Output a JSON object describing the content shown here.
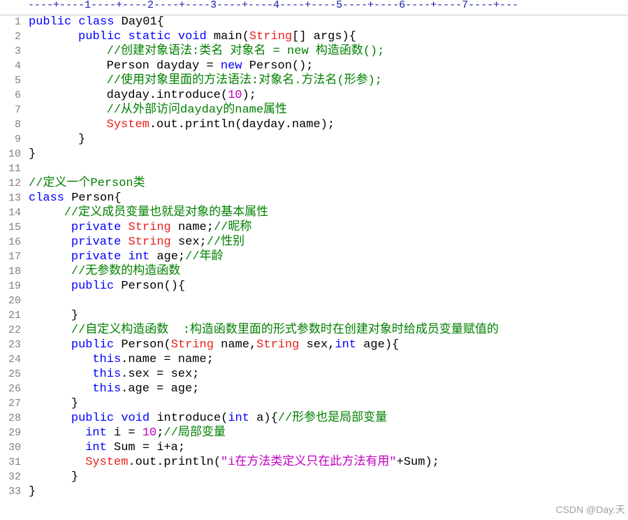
{
  "ruler": "----+----1----+----2----+----3----+----4----+----5----+----6----+----7----+---",
  "watermark": "CSDN @Day.天",
  "colors": {
    "keyword": "#0000ff",
    "type": "#e8201a",
    "comment": "#008000",
    "number": "#c000c0",
    "string": "#c000c0",
    "line_number": "#808080"
  },
  "lines": [
    {
      "num": "1",
      "indent": 0,
      "tokens": [
        [
          "kw",
          "public "
        ],
        [
          "kw",
          "class "
        ],
        [
          "plain",
          "Day01{"
        ]
      ]
    },
    {
      "num": "2",
      "indent": 7,
      "tokens": [
        [
          "kw",
          "public "
        ],
        [
          "kw",
          "static "
        ],
        [
          "kw",
          "void "
        ],
        [
          "plain",
          "main("
        ],
        [
          "ty",
          "String"
        ],
        [
          "plain",
          "[] args){"
        ]
      ]
    },
    {
      "num": "3",
      "indent": 11,
      "tokens": [
        [
          "cm",
          "//创建对象语法:类名 对象名 = new 构造函数();"
        ]
      ]
    },
    {
      "num": "4",
      "indent": 11,
      "tokens": [
        [
          "plain",
          "Person dayday = "
        ],
        [
          "kw",
          "new "
        ],
        [
          "plain",
          "Person();"
        ]
      ]
    },
    {
      "num": "5",
      "indent": 11,
      "tokens": [
        [
          "cm",
          "//使用对象里面的方法语法:对象名.方法名(形参);"
        ]
      ]
    },
    {
      "num": "6",
      "indent": 11,
      "tokens": [
        [
          "plain",
          "dayday.introduce("
        ],
        [
          "num",
          "10"
        ],
        [
          "plain",
          ");"
        ]
      ]
    },
    {
      "num": "7",
      "indent": 11,
      "tokens": [
        [
          "cm",
          "//从外部访问dayday的name属性"
        ]
      ]
    },
    {
      "num": "8",
      "indent": 11,
      "tokens": [
        [
          "ty",
          "System"
        ],
        [
          "plain",
          ".out.println(dayday.name);"
        ]
      ]
    },
    {
      "num": "9",
      "indent": 7,
      "tokens": [
        [
          "plain",
          "}"
        ]
      ]
    },
    {
      "num": "10",
      "indent": 0,
      "tokens": [
        [
          "plain",
          "}"
        ]
      ]
    },
    {
      "num": "11",
      "indent": 0,
      "tokens": []
    },
    {
      "num": "12",
      "indent": 0,
      "tokens": [
        [
          "cm",
          "//定义一个Person类"
        ]
      ]
    },
    {
      "num": "13",
      "indent": 0,
      "tokens": [
        [
          "kw",
          "class "
        ],
        [
          "plain",
          "Person{"
        ]
      ]
    },
    {
      "num": "14",
      "indent": 5,
      "tokens": [
        [
          "cm",
          "//定义成员变量也就是对象的基本属性"
        ]
      ]
    },
    {
      "num": "15",
      "indent": 6,
      "tokens": [
        [
          "kw",
          "private "
        ],
        [
          "ty",
          "String "
        ],
        [
          "plain",
          "name;"
        ],
        [
          "cm",
          "//昵称"
        ]
      ]
    },
    {
      "num": "16",
      "indent": 6,
      "tokens": [
        [
          "kw",
          "private "
        ],
        [
          "ty",
          "String "
        ],
        [
          "plain",
          "sex;"
        ],
        [
          "cm",
          "//性别"
        ]
      ]
    },
    {
      "num": "17",
      "indent": 6,
      "tokens": [
        [
          "kw",
          "private "
        ],
        [
          "kw",
          "int "
        ],
        [
          "plain",
          "age;"
        ],
        [
          "cm",
          "//年龄"
        ]
      ]
    },
    {
      "num": "18",
      "indent": 6,
      "tokens": [
        [
          "cm",
          "//无参数的构造函数"
        ]
      ]
    },
    {
      "num": "19",
      "indent": 6,
      "tokens": [
        [
          "kw",
          "public "
        ],
        [
          "plain",
          "Person(){"
        ]
      ]
    },
    {
      "num": "20",
      "indent": 0,
      "tokens": []
    },
    {
      "num": "21",
      "indent": 6,
      "tokens": [
        [
          "plain",
          "}"
        ]
      ]
    },
    {
      "num": "22",
      "indent": 6,
      "tokens": [
        [
          "cm",
          "//自定义构造函数  :构造函数里面的形式参数时在创建对象时给成员变量赋值的"
        ]
      ]
    },
    {
      "num": "23",
      "indent": 6,
      "tokens": [
        [
          "kw",
          "public "
        ],
        [
          "plain",
          "Person("
        ],
        [
          "ty",
          "String "
        ],
        [
          "plain",
          "name,"
        ],
        [
          "ty",
          "String "
        ],
        [
          "plain",
          "sex,"
        ],
        [
          "kw",
          "int "
        ],
        [
          "plain",
          "age){"
        ]
      ]
    },
    {
      "num": "24",
      "indent": 9,
      "tokens": [
        [
          "kw",
          "this"
        ],
        [
          "plain",
          ".name = name;"
        ]
      ]
    },
    {
      "num": "25",
      "indent": 9,
      "tokens": [
        [
          "kw",
          "this"
        ],
        [
          "plain",
          ".sex = sex;"
        ]
      ]
    },
    {
      "num": "26",
      "indent": 9,
      "tokens": [
        [
          "kw",
          "this"
        ],
        [
          "plain",
          ".age = age;"
        ]
      ]
    },
    {
      "num": "27",
      "indent": 6,
      "tokens": [
        [
          "plain",
          "}"
        ]
      ]
    },
    {
      "num": "28",
      "indent": 6,
      "tokens": [
        [
          "kw",
          "public "
        ],
        [
          "kw",
          "void "
        ],
        [
          "plain",
          "introduce("
        ],
        [
          "kw",
          "int "
        ],
        [
          "plain",
          "a){"
        ],
        [
          "cm",
          "//形参也是局部变量"
        ]
      ]
    },
    {
      "num": "29",
      "indent": 8,
      "tokens": [
        [
          "kw",
          "int "
        ],
        [
          "plain",
          "i = "
        ],
        [
          "num",
          "10"
        ],
        [
          "plain",
          ";"
        ],
        [
          "cm",
          "//局部变量"
        ]
      ]
    },
    {
      "num": "30",
      "indent": 8,
      "tokens": [
        [
          "kw",
          "int "
        ],
        [
          "plain",
          "Sum = i+a;"
        ]
      ]
    },
    {
      "num": "31",
      "indent": 8,
      "tokens": [
        [
          "ty",
          "System"
        ],
        [
          "plain",
          ".out.println("
        ],
        [
          "str",
          "\"i在方法类定义只在此方法有用\""
        ],
        [
          "plain",
          "+Sum);"
        ]
      ]
    },
    {
      "num": "32",
      "indent": 6,
      "tokens": [
        [
          "plain",
          "}"
        ]
      ]
    },
    {
      "num": "33",
      "indent": 0,
      "tokens": [
        [
          "plain",
          "}"
        ]
      ]
    }
  ]
}
